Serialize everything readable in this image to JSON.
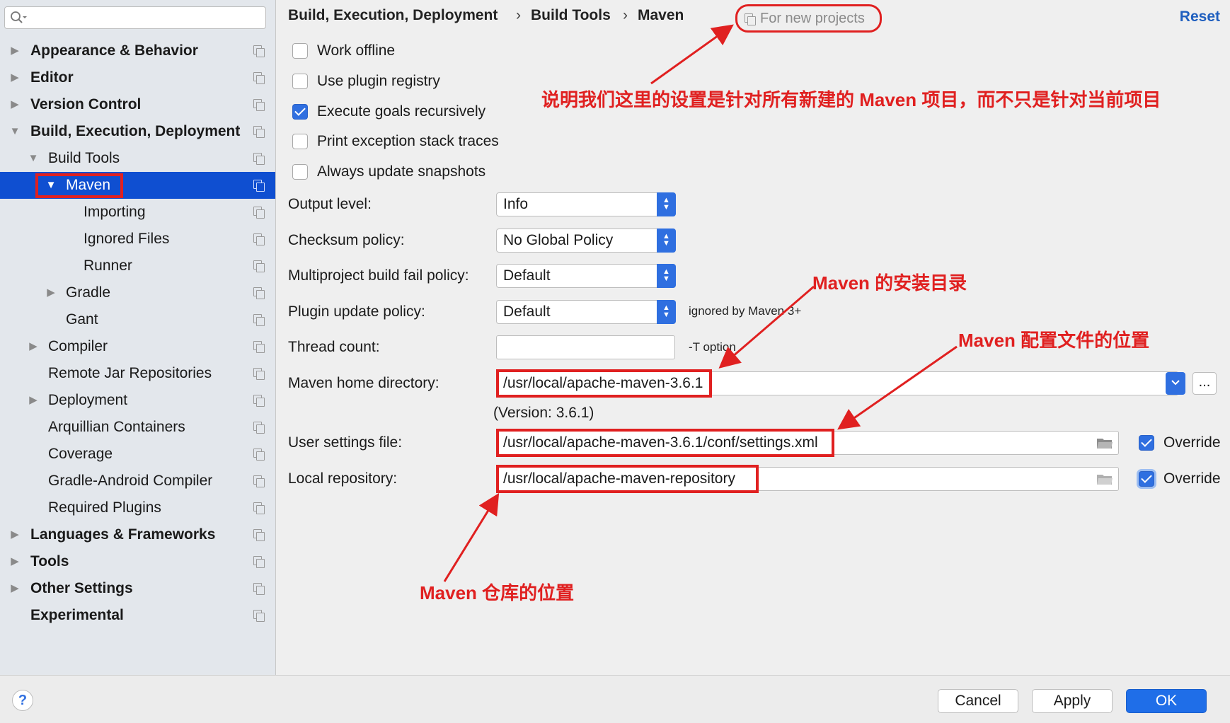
{
  "search": {
    "value": ""
  },
  "sidebar": {
    "items": [
      {
        "label": "Appearance & Behavior"
      },
      {
        "label": "Editor"
      },
      {
        "label": "Version Control"
      },
      {
        "label": "Build, Execution, Deployment"
      },
      {
        "label": "Build Tools"
      },
      {
        "label": "Maven"
      },
      {
        "label": "Importing"
      },
      {
        "label": "Ignored Files"
      },
      {
        "label": "Runner"
      },
      {
        "label": "Gradle"
      },
      {
        "label": "Gant"
      },
      {
        "label": "Compiler"
      },
      {
        "label": "Remote Jar Repositories"
      },
      {
        "label": "Deployment"
      },
      {
        "label": "Arquillian Containers"
      },
      {
        "label": "Coverage"
      },
      {
        "label": "Gradle-Android Compiler"
      },
      {
        "label": "Required Plugins"
      },
      {
        "label": "Languages & Frameworks"
      },
      {
        "label": "Tools"
      },
      {
        "label": "Other Settings"
      },
      {
        "label": "Experimental"
      }
    ]
  },
  "header": {
    "breadcrumb": [
      "Build, Execution, Deployment",
      "Build Tools",
      "Maven"
    ],
    "separator": "›",
    "for_new_projects": "For new projects",
    "reset": "Reset"
  },
  "options": {
    "work_offline": {
      "label": "Work offline",
      "checked": false
    },
    "use_plugin_registry": {
      "label": "Use plugin registry",
      "checked": false
    },
    "execute_goals_recursively": {
      "label": "Execute goals recursively",
      "checked": true
    },
    "print_exception_stack_traces": {
      "label": "Print exception stack traces",
      "checked": false
    },
    "always_update_snapshots": {
      "label": "Always update snapshots",
      "checked": false
    }
  },
  "form": {
    "output_level": {
      "label": "Output level:",
      "value": "Info"
    },
    "checksum_policy": {
      "label": "Checksum policy:",
      "value": "No Global Policy"
    },
    "multiproject_fail_policy": {
      "label": "Multiproject build fail policy:",
      "value": "Default"
    },
    "plugin_update_policy": {
      "label": "Plugin update policy:",
      "value": "Default",
      "hint": "ignored by Maven 3+"
    },
    "thread_count": {
      "label": "Thread count:",
      "value": "",
      "hint": "-T option"
    },
    "maven_home": {
      "label": "Maven home directory:",
      "value": "/usr/local/apache-maven-3.6.1",
      "version": "(Version: 3.6.1)",
      "browse": "..."
    },
    "user_settings": {
      "label": "User settings file:",
      "value": "/usr/local/apache-maven-3.6.1/conf/settings.xml",
      "override_label": "Override",
      "override": true
    },
    "local_repository": {
      "label": "Local repository:",
      "value": "/usr/local/apache-maven-repository",
      "override_label": "Override",
      "override": true
    }
  },
  "annotations": {
    "for_new_projects": "说明我们这里的设置是针对所有新建的 Maven 项目，而不只是针对当前项目",
    "maven_home": "Maven 的安装目录",
    "settings_file": "Maven 配置文件的位置",
    "repository": "Maven 仓库的位置"
  },
  "footer": {
    "help": "?",
    "cancel": "Cancel",
    "apply": "Apply",
    "ok": "OK"
  },
  "colors": {
    "selection": "#0f4fd1",
    "accent": "#2f6fe0",
    "annotation": "#e02020"
  }
}
